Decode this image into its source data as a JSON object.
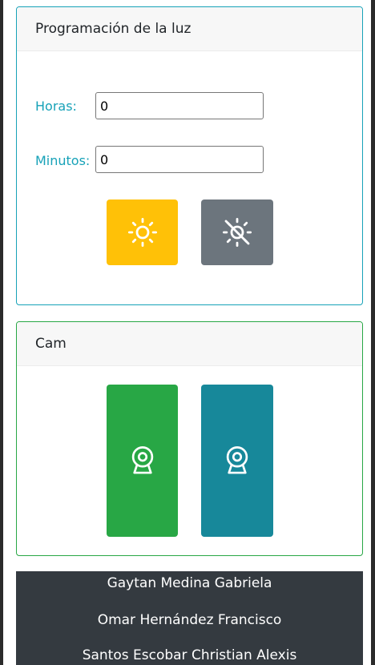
{
  "light_schedule": {
    "title": "Programación de la luz",
    "hours_label": "Horas:",
    "hours_value": "0",
    "minutes_label": "Minutos:",
    "minutes_value": "0",
    "on_button": {
      "icon": "sun-icon",
      "color": "#ffc107"
    },
    "off_button": {
      "icon": "sun-off-icon",
      "color": "#6c757d"
    }
  },
  "cam": {
    "title": "Cam",
    "buttons": [
      {
        "icon": "webcam-icon",
        "color": "#28a745"
      },
      {
        "icon": "webcam-icon",
        "color": "#17889a"
      }
    ]
  },
  "footer": {
    "names": [
      "Gaytan Medina Gabriela",
      "Omar Hernández Francisco",
      "Santos Escobar Christian Alexis"
    ]
  },
  "colors": {
    "info": "#17a2b8",
    "success": "#28a745",
    "dark": "#343a40"
  }
}
